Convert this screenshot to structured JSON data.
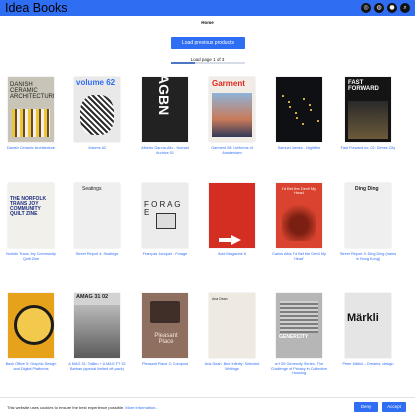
{
  "header": {
    "brand": "Idea Books",
    "icons": [
      "instagram-icon",
      "cart-icon",
      "account-icon",
      "search-icon"
    ]
  },
  "main": {
    "home_label": "Home",
    "load_button": "Load previous products",
    "page_indicator": "Load page 1 of 3",
    "progress_fraction": 0.33
  },
  "products": [
    {
      "title": "Danish Ceramic Architecture",
      "cover_text": "DANISH CERAMIC ARCHITECTURE",
      "cover_bg": "#c9c4b8"
    },
    {
      "title": "Volume 62",
      "cover_text": "volume 62",
      "cover_bg": "#e9e9e9"
    },
    {
      "title": "Alberto García-Alix - Nomad Archive 01",
      "cover_text": "AGBN",
      "cover_bg": "#222222"
    },
    {
      "title": "Garment 28: Uniforms of Amsterdam",
      "cover_text": "Garment",
      "cover_bg": "#f1ede6"
    },
    {
      "title": "Samuel James - Nightfire",
      "cover_text": "",
      "cover_bg": "#0e1014"
    },
    {
      "title": "Fast Forward no. 02: Dense City",
      "cover_text": "FAST FORWARD",
      "cover_bg": "#141414"
    },
    {
      "title": "Norfolk Trans Joy Community Quilt Zine",
      "cover_text": "THE NORFOLK TRANS JOY COMMUNITY QUILT ZINE",
      "cover_bg": "#f2f0ea"
    },
    {
      "title": "Street Report 4: Seatings",
      "cover_text": "Seatings",
      "cover_bg": "#efefef"
    },
    {
      "title": "François Jonquet - Forage",
      "cover_text": "F O R A G E",
      "cover_bg": "#ececec"
    },
    {
      "title": "Acid Magazine 6",
      "cover_text": "",
      "cover_bg": "#d42d22"
    },
    {
      "title": "Carlos Alba 'I'd Bet the Devil My Head'",
      "cover_text": "I'd Bet the Devil My Head",
      "cover_bg": "#d9432f"
    },
    {
      "title": "Street Report 3: Ding Ding (trams in Hong Kong)",
      "cover_text": "Ding Ding",
      "cover_bg": "#efefef"
    },
    {
      "title": "Back Office 5: Graphic Design and Digital Platforms",
      "cover_text": "",
      "cover_bg": "#e6a21b"
    },
    {
      "title": "A MAG 31: Tailleu + A MAG FT 32 Barbas (special limited off-pack)",
      "cover_text": "AMAG 31 02",
      "cover_bg": "#d3d3d3"
    },
    {
      "title": "Pleasant Place 3: Compost",
      "cover_text": "Pleasant Place",
      "cover_bg": "#8f6f5f"
    },
    {
      "title": "Ana Dean, Bed Infinity: Selected Writings",
      "cover_text": "Ana Dean",
      "cover_bg": "#eeeae2"
    },
    {
      "title": "a+t 59 Genercity Series. The Challenge of Privacy in Collective Housing",
      "cover_text": "GENERCITY",
      "cover_bg": "#b6b6b6"
    },
    {
      "title": "Peter Märkli – Dreams, design",
      "cover_text": "Märkli",
      "cover_bg": "#e5e5e5"
    }
  ],
  "cookie": {
    "text": "This website uses cookies to ensure the best experience possible.",
    "more_link": "More information...",
    "deny": "Deny",
    "accept": "Accept"
  }
}
